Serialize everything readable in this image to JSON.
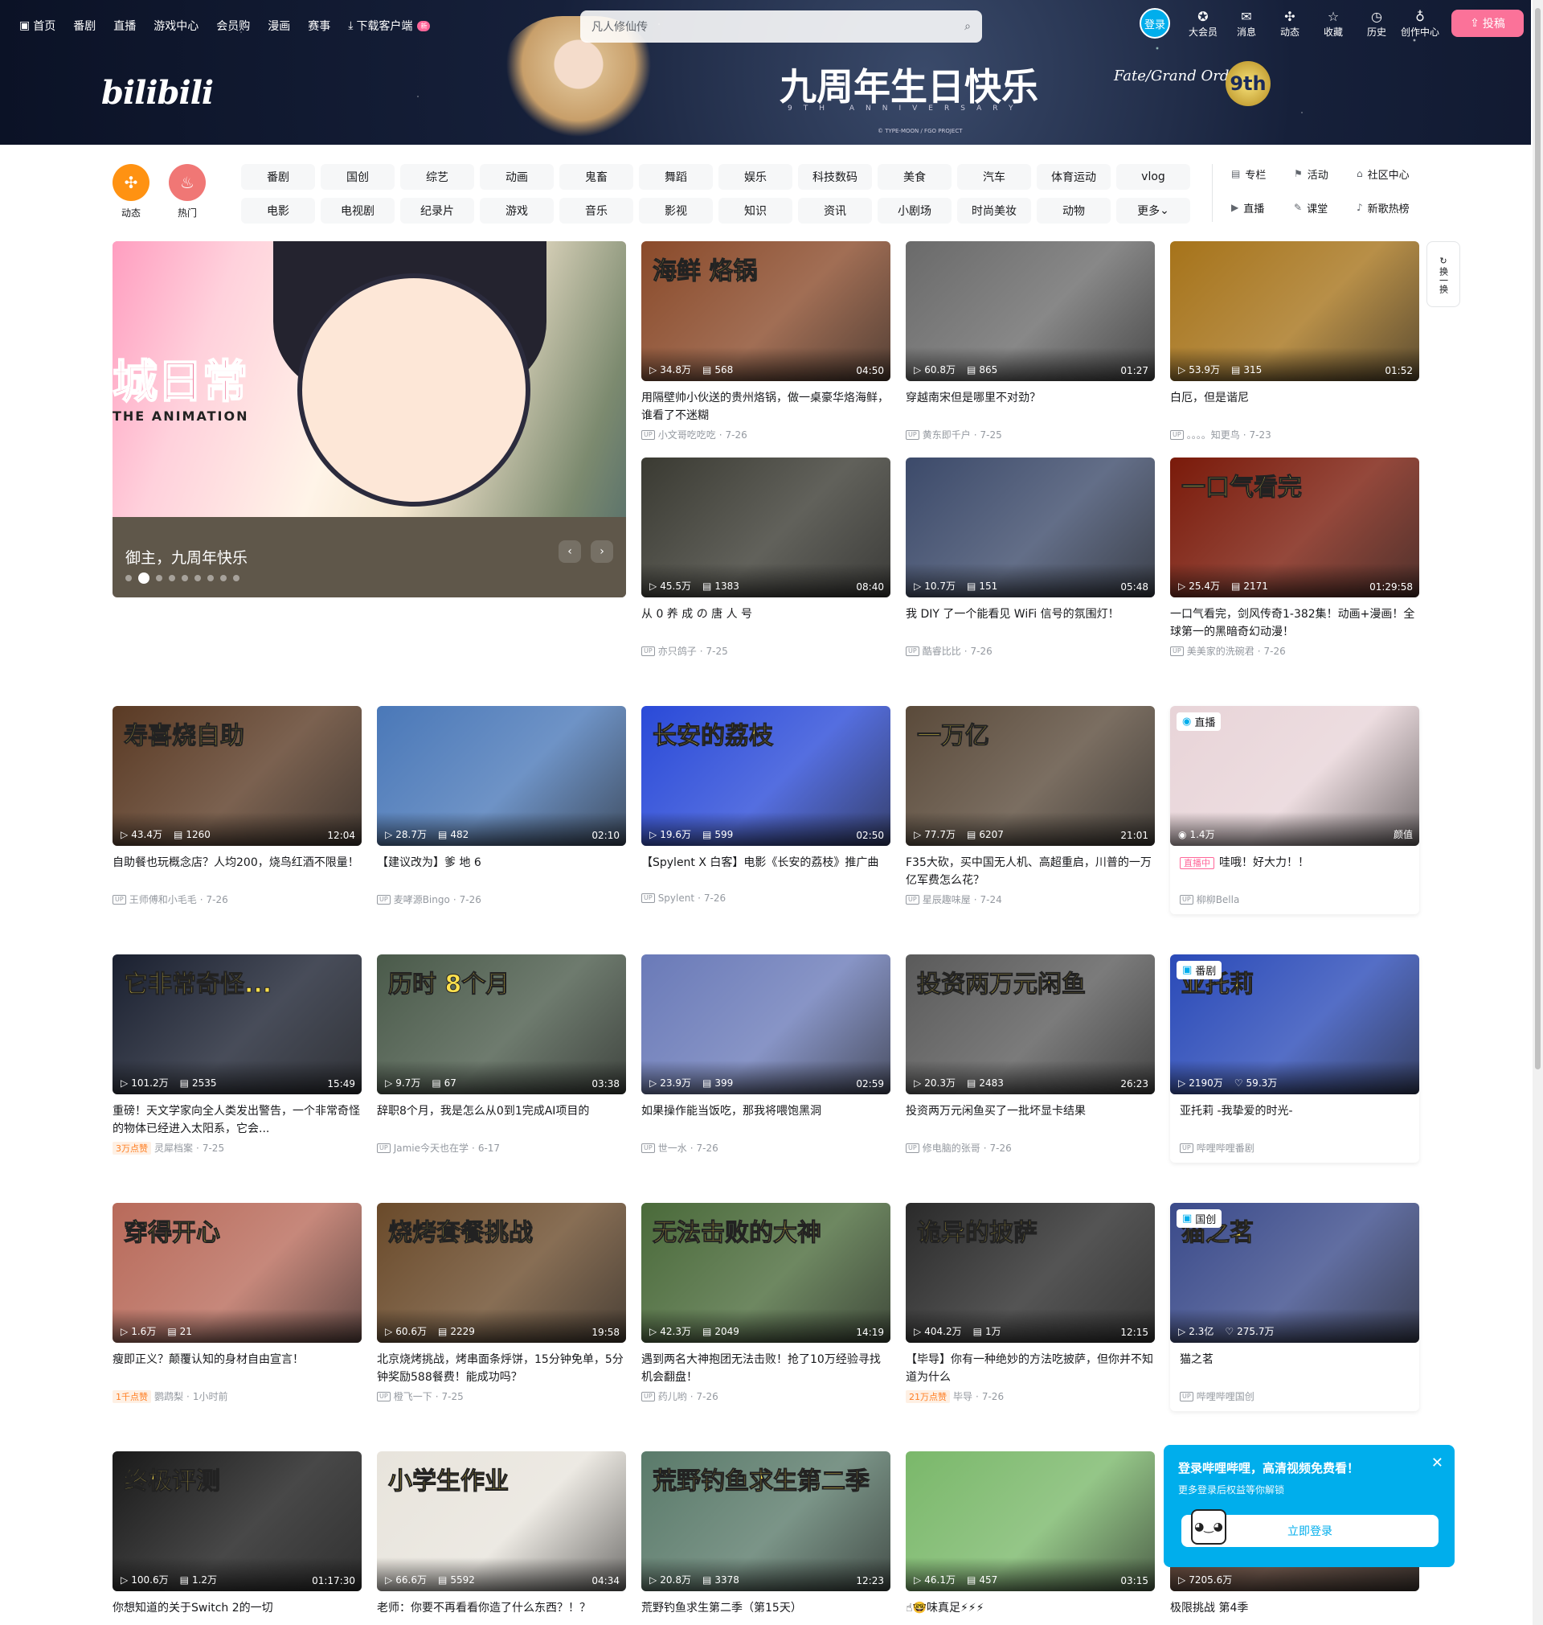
{
  "topnav": {
    "items": [
      "首页",
      "番剧",
      "直播",
      "游戏中心",
      "会员购",
      "漫画",
      "赛事"
    ],
    "download": "下载客户端",
    "download_badge": "新"
  },
  "search": {
    "placeholder": "凡人修仙传"
  },
  "user": {
    "login": "登录",
    "items": [
      {
        "label": "大会员",
        "icon": "vip-icon",
        "glyph": "✪"
      },
      {
        "label": "消息",
        "icon": "message-icon",
        "glyph": "✉"
      },
      {
        "label": "动态",
        "icon": "dynamic-icon",
        "glyph": "✣"
      },
      {
        "label": "收藏",
        "icon": "favorite-icon",
        "glyph": "☆"
      },
      {
        "label": "历史",
        "icon": "history-icon",
        "glyph": "◷"
      },
      {
        "label": "创作中心",
        "icon": "creator-icon",
        "glyph": "♁"
      }
    ],
    "upload": "投稿"
  },
  "banner": {
    "logo": "bilibili",
    "title": "九周年生日快乐",
    "subtitle": "9TH ANNIVERSARY",
    "copyright": "© TYPE-MOON / FGO PROJECT",
    "fgo": "Fate/Grand Order",
    "badge": "9th"
  },
  "channel": {
    "dynamic": "动态",
    "hot": "热门",
    "chips": [
      "番剧",
      "国创",
      "综艺",
      "动画",
      "鬼畜",
      "舞蹈",
      "娱乐",
      "科技数码",
      "美食",
      "汽车",
      "体育运动",
      "vlog",
      "电影",
      "电视剧",
      "纪录片",
      "游戏",
      "音乐",
      "影视",
      "知识",
      "资讯",
      "小剧场",
      "时尚美妆",
      "动物",
      "更多"
    ],
    "side": [
      {
        "label": "专栏",
        "glyph": "▤"
      },
      {
        "label": "活动",
        "glyph": "⚑"
      },
      {
        "label": "社区中心",
        "glyph": "⌂"
      },
      {
        "label": "直播",
        "glyph": "▶"
      },
      {
        "label": "课堂",
        "glyph": "✎"
      },
      {
        "label": "新歌热榜",
        "glyph": "♪"
      }
    ]
  },
  "carousel": {
    "title": "御主，九周年快乐",
    "art_text": "城日常",
    "art_sub": "THE ANIMATION",
    "prev": "‹",
    "next": "›"
  },
  "refresh": {
    "label": "换一换"
  },
  "cards": [
    {
      "title": "用隔壁帅小伙送的贵州烙锅，做一桌豪华烙海鲜，谁看了不迷糊",
      "views": "34.8万",
      "danmaku": "568",
      "duration": "04:50",
      "author": "小文哥吃吃吃",
      "date": "7-26",
      "color": "#8a4a2a",
      "text": "海鲜 烙锅"
    },
    {
      "title": "穿越南宋但是哪里不对劲？",
      "views": "60.8万",
      "danmaku": "865",
      "duration": "01:27",
      "author": "黄东即千户",
      "date": "7-25",
      "color": "#6a6a6a",
      "text": ""
    },
    {
      "title": "白厄，但是谐尼",
      "views": "53.9万",
      "danmaku": "315",
      "duration": "01:52",
      "author": "。。。。知更鸟",
      "date": "7-23",
      "color": "#a6731a",
      "text": ""
    },
    {
      "title": "从 0 养 成 の 唐 人 号",
      "views": "45.5万",
      "danmaku": "1383",
      "duration": "08:40",
      "author": "亦只鸽子",
      "date": "7-25",
      "color": "#3a3a32",
      "text": ""
    },
    {
      "title": "我 DIY 了一个能看见 WiFi 信号的氛围灯！",
      "views": "10.7万",
      "danmaku": "151",
      "duration": "05:48",
      "author": "酷睿比比",
      "date": "7-26",
      "color": "#3c4a6a",
      "text": ""
    },
    {
      "title": "一口气看完，剑风传奇1-382集！动画+漫画！全球第一的黑暗奇幻动漫！",
      "views": "25.4万",
      "danmaku": "2171",
      "duration": "01:29:58",
      "author": "美美家的洗碗君",
      "date": "7-26",
      "color": "#7a1a0a",
      "text": "一口气看完"
    },
    {
      "title": "自助餐也玩概念店？人均200，烧鸟红酒不限量！",
      "views": "43.4万",
      "danmaku": "1260",
      "duration": "12:04",
      "author": "王师傅和小毛毛",
      "date": "7-26",
      "color": "#5a3a24",
      "text": "寿喜烧自助"
    },
    {
      "title": "【建议改为】爹 地 6",
      "views": "28.7万",
      "danmaku": "482",
      "duration": "02:10",
      "author": "麦哮源Bingo",
      "date": "7-26",
      "color": "#4a78b8",
      "text": ""
    },
    {
      "title": "【Spylent X 白客】电影《长安的荔枝》推广曲",
      "views": "19.6万",
      "danmaku": "599",
      "duration": "02:50",
      "author": "Spylent",
      "date": "7-26",
      "color": "#2a4ad8",
      "text": "长安的荔枝"
    },
    {
      "title": "F35大砍，买中国无人机、高超重启，川普的一万亿军费怎么花？",
      "views": "77.7万",
      "danmaku": "6207",
      "duration": "21:01",
      "author": "星辰趣味屋",
      "date": "7-24",
      "color": "#5a4a3a",
      "text": "一万亿"
    },
    {
      "title": "哇哦！好大力！！",
      "views": "1.4万",
      "danmaku": "",
      "duration": "颜值",
      "author": "柳柳Bella",
      "date": "",
      "color": "#e8d4d8",
      "text": "",
      "live": true,
      "corner": "直播",
      "live_badge": "直播中"
    },
    {
      "title": "重磅！天文学家向全人类发出警告，一个非常奇怪的物体已经进入太阳系，它会...",
      "views": "101.2万",
      "danmaku": "2535",
      "duration": "15:49",
      "author": "灵犀档案",
      "date": "7-25",
      "color": "#1a2030",
      "text": "它非常奇怪...",
      "hot": "3万点赞"
    },
    {
      "title": "辞职8个月，我是怎么从0到1完成AI项目的",
      "views": "9.7万",
      "danmaku": "67",
      "duration": "03:38",
      "author": "Jamie今天也在学",
      "date": "6-17",
      "color": "#4a5a4a",
      "text": "历时 8个月"
    },
    {
      "title": "如果操作能当饭吃，那我将喂饱黑洞",
      "views": "23.9万",
      "danmaku": "399",
      "duration": "02:59",
      "author": "世一水",
      "date": "7-26",
      "color": "#6a7ab8",
      "text": ""
    },
    {
      "title": "投资两万元闲鱼买了一批坏显卡结果",
      "views": "20.3万",
      "danmaku": "2483",
      "duration": "26:23",
      "author": "修电脑的张哥",
      "date": "7-26",
      "color": "#5a5a5a",
      "text": "投资两万元闲鱼"
    },
    {
      "title": "亚托莉 -我挚爱的时光-",
      "views": "2190万",
      "danmaku": "59.3万",
      "duration": "",
      "author": "哔哩哔哩番剧",
      "date": "",
      "color": "#2a4ab8",
      "text": "亚托莉",
      "corner": "番剧",
      "special": true
    },
    {
      "title": "瘦即正义？颠覆认知的身材自由宣言！",
      "views": "1.6万",
      "danmaku": "21",
      "duration": "",
      "author": "鹦鹉梨",
      "date": "1小时前",
      "color": "#b86a5a",
      "text": "穿得开心",
      "hot": "1千点赞"
    },
    {
      "title": "北京烧烤挑战，烤串面条烀饼，15分钟免单，5分钟奖励588餐费！能成功吗？",
      "views": "60.6万",
      "danmaku": "2229",
      "duration": "19:58",
      "author": "橙飞一下",
      "date": "7-25",
      "color": "#6a4a2a",
      "text": "烧烤套餐挑战"
    },
    {
      "title": "遇到两名大神抱团无法击败！抢了10万经验寻找机会翻盘！",
      "views": "42.3万",
      "danmaku": "2049",
      "duration": "14:19",
      "author": "药儿哟",
      "date": "7-26",
      "color": "#4a6a3a",
      "text": "无法击败的大神"
    },
    {
      "title": "【毕导】你有一种绝妙的方法吃披萨，但你并不知道为什么",
      "views": "404.2万",
      "danmaku": "1万",
      "duration": "12:15",
      "author": "毕导",
      "date": "7-26",
      "color": "#2a2a2a",
      "text": "诡异的披萨",
      "hot": "21万点赞"
    },
    {
      "title": "猫之茗",
      "views": "2.3亿",
      "danmaku": "275.7万",
      "duration": "",
      "author": "哔哩哔哩国创",
      "date": "",
      "color": "#3a4a8a",
      "text": "猫之茗",
      "corner": "国创",
      "special": true
    },
    {
      "title": "你想知道的关于Switch 2的一切",
      "views": "100.6万",
      "danmaku": "1.2万",
      "duration": "01:17:30",
      "author": "",
      "date": "",
      "color": "#1a1a1a",
      "text": "终极评测"
    },
    {
      "title": "老师：你要不再看看你造了什么东西？！？",
      "views": "66.6万",
      "danmaku": "5592",
      "duration": "04:34",
      "author": "",
      "date": "",
      "color": "#e8e4dc",
      "text": "小学生作业"
    },
    {
      "title": "荒野钓鱼求生第二季（第15天）",
      "views": "20.8万",
      "danmaku": "3378",
      "duration": "12:23",
      "author": "",
      "date": "",
      "color": "#5a7a6a",
      "text": "荒野钓鱼求生第二季"
    },
    {
      "title": "☝🤓味真足⚡⚡⚡",
      "views": "46.1万",
      "danmaku": "457",
      "duration": "03:15",
      "author": "",
      "date": "",
      "color": "#7ab86a",
      "text": ""
    },
    {
      "title": "极限挑战 第4季",
      "views": "7205.6万",
      "danmaku": "",
      "duration": "",
      "author": "",
      "date": "",
      "color": "#5a3a2a",
      "text": ""
    }
  ],
  "popup": {
    "title": "登录哔哩哔哩，高清视频免费看！",
    "subtitle": "更多登录后权益等你解锁",
    "button": "立即登录",
    "close": "✕"
  }
}
